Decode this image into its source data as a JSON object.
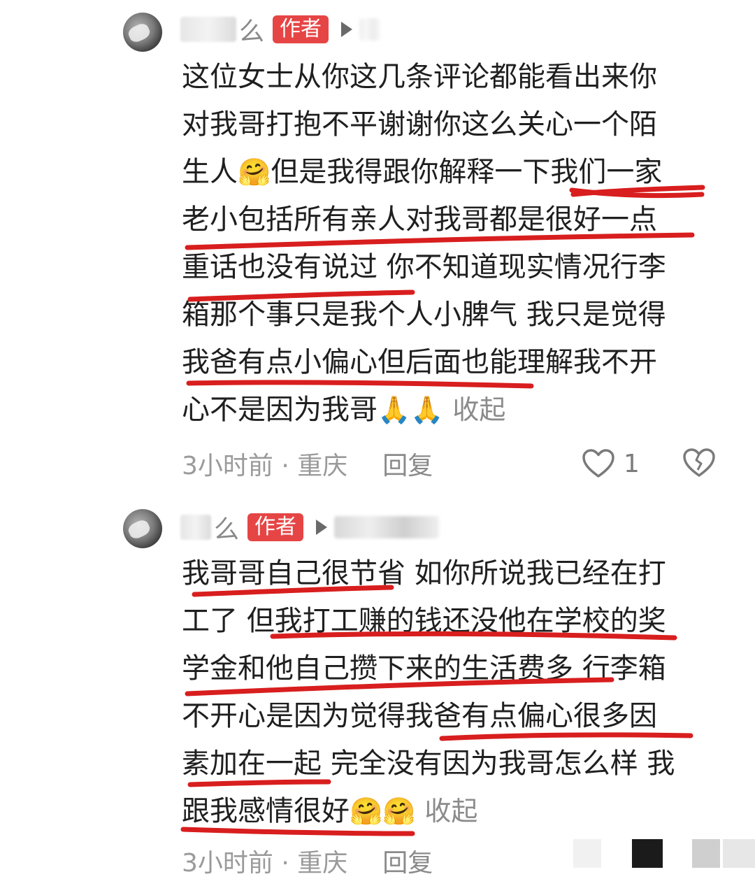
{
  "comments": [
    {
      "author_visible": "么",
      "author_badge": "作者",
      "line1": "这位女士从你这几条评论都能看出来你",
      "line2": "对我哥打抱不平谢谢你这么关心一个陌",
      "line3a": "生人",
      "line3b": "但是我得跟你解释一下我们一家",
      "line4": "老小包括所有亲人对我哥都是很好一点",
      "line5": "重话也没有说过 你不知道现实情况行李",
      "line6": "箱那个事只是我个人小脾气 我只是觉得",
      "line7": "我爸有点小偏心但后面也能理解我不开",
      "line8": "心不是因为我哥",
      "emoji_a": "🤗",
      "emoji_b": "🙏🙏",
      "collapse_label": "收起",
      "time_location": "3小时前 · 重庆",
      "reply_label": "回复",
      "like_count": "1",
      "icons": [
        "heart-icon",
        "broken-heart-icon"
      ]
    },
    {
      "author_visible": "么",
      "author_badge": "作者",
      "line1": "我哥哥自己很节省 如你所说我已经在打",
      "line2": "工了 但我打工赚的钱还没他在学校的奖",
      "line3": "学金和他自己攒下来的生活费多 行李箱",
      "line4": "不开心是因为觉得我爸有点偏心很多因",
      "line5": "素加在一起 完全没有因为我哥怎么样 我",
      "line6": "跟我感情很好",
      "emoji": "🤗🤗",
      "collapse_label": "收起",
      "time_location": "3小时前 · 重庆",
      "reply_label": "回复"
    }
  ],
  "colors": {
    "badge": "#e64545",
    "underline": "#d81e1e",
    "meta_text": "#9a9a9a"
  }
}
